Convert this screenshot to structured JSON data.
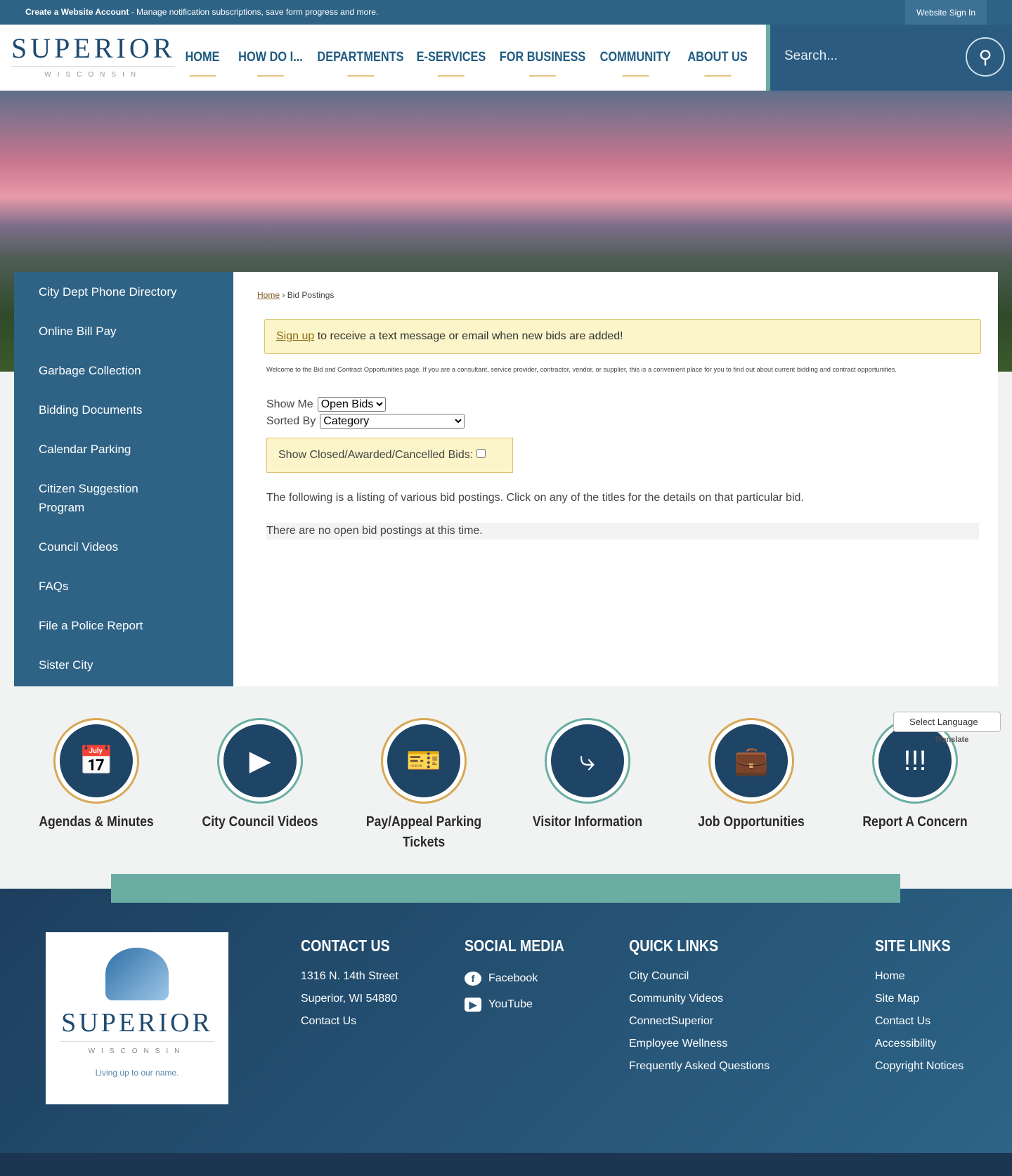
{
  "topbar": {
    "account_link": "Create a Website Account",
    "account_desc": " - Manage notification subscriptions, save form progress and more.",
    "signin": "Website Sign In"
  },
  "logo": {
    "name": "SUPERIOR",
    "state": "WISCONSIN"
  },
  "nav": [
    "HOME",
    "HOW DO I...",
    "DEPARTMENTS",
    "E-SERVICES",
    "FOR BUSINESS",
    "COMMUNITY",
    "ABOUT US"
  ],
  "search": {
    "placeholder": "Search..."
  },
  "sidebar": [
    "City Dept Phone Directory",
    "Online Bill Pay",
    "Garbage Collection",
    "Bidding Documents",
    "Calendar Parking",
    "Citizen Suggestion Program",
    "Council Videos",
    "FAQs",
    "File a Police Report",
    "Sister City"
  ],
  "breadcrumb": {
    "home": "Home",
    "sep": " › ",
    "current": "Bid Postings"
  },
  "alert": {
    "link": "Sign up",
    "text": " to receive a text message or email when new bids are added!"
  },
  "welcome": "Welcome to the Bid and Contract Opportunities page. If you are a consultant, service provider, contractor, vendor, or supplier, this is a convenient place for you to find out about current bidding and contract opportunities.",
  "filters": {
    "show_label": "Show Me",
    "show_value": "Open Bids",
    "sort_label": "Sorted By",
    "sort_value": "Category",
    "closed_label": "Show Closed/Awarded/Cancelled Bids:"
  },
  "listing_text": "The following is a listing of various bid postings. Click on any of the titles for the details on that particular bid.",
  "no_bids": "There are no open bid postings at this time.",
  "tiles": [
    "Agendas & Minutes",
    "City Council Videos",
    "Pay/Appeal Parking Tickets",
    "Visitor Information",
    "Job Opportunities",
    "Report A Concern"
  ],
  "translate": {
    "select": "Select Language",
    "powered": "Translate"
  },
  "footer": {
    "logo_tagline": "Living up to our name.",
    "contact": {
      "title": "CONTACT US",
      "lines": [
        "1316 N. 14th Street",
        "Superior, WI 54880",
        "Contact Us"
      ]
    },
    "social": {
      "title": "SOCIAL MEDIA",
      "items": [
        "Facebook",
        "YouTube"
      ]
    },
    "quick": {
      "title": "QUICK LINKS",
      "items": [
        "City Council",
        "Community Videos",
        "ConnectSuperior",
        "Employee Wellness",
        "Frequently Asked Questions"
      ]
    },
    "site": {
      "title": "SITE LINKS",
      "items": [
        "Home",
        "Site Map",
        "Contact Us",
        "Accessibility",
        "Copyright Notices"
      ]
    }
  }
}
